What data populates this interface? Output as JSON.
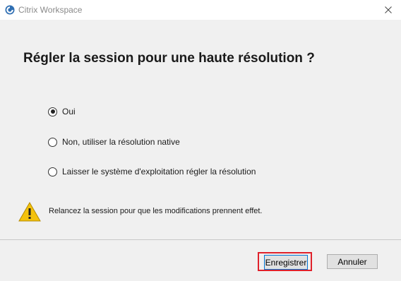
{
  "window": {
    "title": "Citrix Workspace",
    "icon": "citrix-workspace-icon",
    "close_icon": "close-icon"
  },
  "dialog": {
    "heading": "Régler la session pour une haute résolution ?",
    "options": [
      {
        "label": "Oui",
        "selected": true
      },
      {
        "label": "Non, utiliser la résolution native",
        "selected": false
      },
      {
        "label": "Laisser le système d'exploitation régler la résolution",
        "selected": false
      }
    ],
    "warning": {
      "icon": "warning-icon",
      "text": "Relancez la session pour que les modifications prennent effet."
    }
  },
  "footer": {
    "save_label": "Enregistrer",
    "cancel_label": "Annuler"
  },
  "colors": {
    "highlight": "#e0212b",
    "background": "#f0f0f0",
    "accent": "#0078d7"
  }
}
